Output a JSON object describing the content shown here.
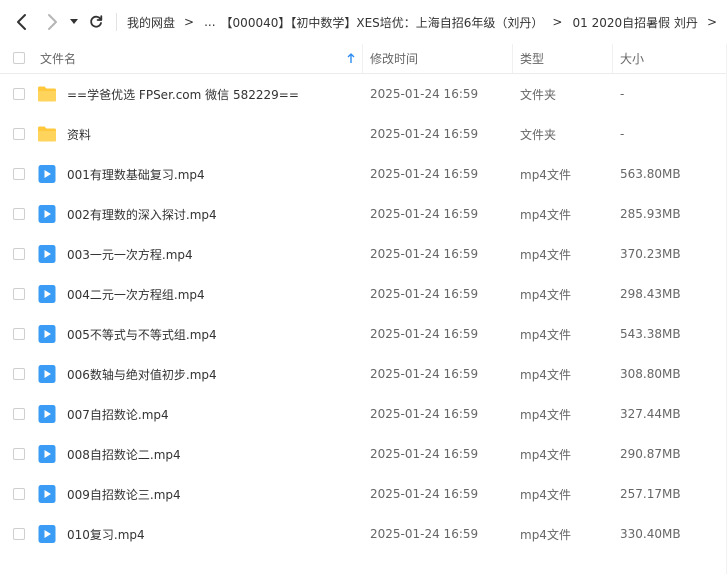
{
  "breadcrumb": {
    "items": [
      "我的网盘",
      "...",
      "【000040】【初中数学】XES培优：上海自招6年级（刘丹）",
      "01 2020自招暑假 刘丹"
    ],
    "separator": ">"
  },
  "header": {
    "name": "文件名",
    "modified": "修改时间",
    "type": "类型",
    "size": "大小"
  },
  "colors": {
    "folder": "#FFC83D",
    "video": "#3A9CF5",
    "sort_arrow": "#2D8CF0"
  },
  "files": [
    {
      "icon": "folder-icon",
      "name": "==学爸优选 FPSer.com 微信 582229==",
      "modified": "2025-01-24 16:59",
      "type": "文件夹",
      "size": "-"
    },
    {
      "icon": "folder-icon",
      "name": "资料",
      "modified": "2025-01-24 16:59",
      "type": "文件夹",
      "size": "-"
    },
    {
      "icon": "video-file-icon",
      "name": "001有理数基础复习.mp4",
      "modified": "2025-01-24 16:59",
      "type": "mp4文件",
      "size": "563.80MB"
    },
    {
      "icon": "video-file-icon",
      "name": "002有理数的深入探讨.mp4",
      "modified": "2025-01-24 16:59",
      "type": "mp4文件",
      "size": "285.93MB"
    },
    {
      "icon": "video-file-icon",
      "name": "003一元一次方程.mp4",
      "modified": "2025-01-24 16:59",
      "type": "mp4文件",
      "size": "370.23MB"
    },
    {
      "icon": "video-file-icon",
      "name": "004二元一次方程组.mp4",
      "modified": "2025-01-24 16:59",
      "type": "mp4文件",
      "size": "298.43MB"
    },
    {
      "icon": "video-file-icon",
      "name": "005不等式与不等式组.mp4",
      "modified": "2025-01-24 16:59",
      "type": "mp4文件",
      "size": "543.38MB"
    },
    {
      "icon": "video-file-icon",
      "name": "006数轴与绝对值初步.mp4",
      "modified": "2025-01-24 16:59",
      "type": "mp4文件",
      "size": "308.80MB"
    },
    {
      "icon": "video-file-icon",
      "name": "007自招数论.mp4",
      "modified": "2025-01-24 16:59",
      "type": "mp4文件",
      "size": "327.44MB"
    },
    {
      "icon": "video-file-icon",
      "name": "008自招数论二.mp4",
      "modified": "2025-01-24 16:59",
      "type": "mp4文件",
      "size": "290.87MB"
    },
    {
      "icon": "video-file-icon",
      "name": "009自招数论三.mp4",
      "modified": "2025-01-24 16:59",
      "type": "mp4文件",
      "size": "257.17MB"
    },
    {
      "icon": "video-file-icon",
      "name": "010复习.mp4",
      "modified": "2025-01-24 16:59",
      "type": "mp4文件",
      "size": "330.40MB"
    }
  ]
}
